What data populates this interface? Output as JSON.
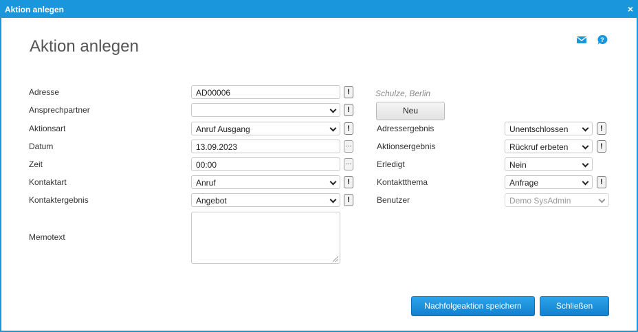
{
  "window": {
    "title": "Aktion anlegen",
    "close_glyph": "×"
  },
  "page_title": "Aktion anlegen",
  "icons": {
    "mail": "mail-icon",
    "help": "help-icon"
  },
  "left": {
    "adresse": {
      "label": "Adresse",
      "value": "AD00006",
      "hint": "Schulze, Berlin"
    },
    "ansprechpartner": {
      "label": "Ansprechpartner",
      "value": ""
    },
    "aktionsart": {
      "label": "Aktionsart",
      "value": "Anruf Ausgang"
    },
    "datum": {
      "label": "Datum",
      "value": "13.09.2023"
    },
    "zeit": {
      "label": "Zeit",
      "value": "00:00"
    },
    "kontaktart": {
      "label": "Kontaktart",
      "value": "Anruf"
    },
    "kontaktergebnis": {
      "label": "Kontaktergebnis",
      "value": "Angebot"
    },
    "memotext": {
      "label": "Memotext",
      "value": ""
    }
  },
  "right": {
    "neu_button": "Neu",
    "adressergebnis": {
      "label": "Adressergebnis",
      "value": "Unentschlossen"
    },
    "aktionsergebnis": {
      "label": "Aktionsergebnis",
      "value": "Rückruf erbeten"
    },
    "erledigt": {
      "label": "Erledigt",
      "value": "Nein"
    },
    "kontaktthema": {
      "label": "Kontaktthema",
      "value": "Anfrage"
    },
    "benutzer": {
      "label": "Benutzer",
      "value": "Demo SysAdmin"
    }
  },
  "glyphs": {
    "exclaim": "!",
    "dots": "..."
  },
  "buttons": {
    "save_followup": "Nachfolgeaktion speichern",
    "close": "Schließen"
  },
  "colors": {
    "accent": "#1a97dc",
    "primary_button": "#1a8ad8"
  }
}
